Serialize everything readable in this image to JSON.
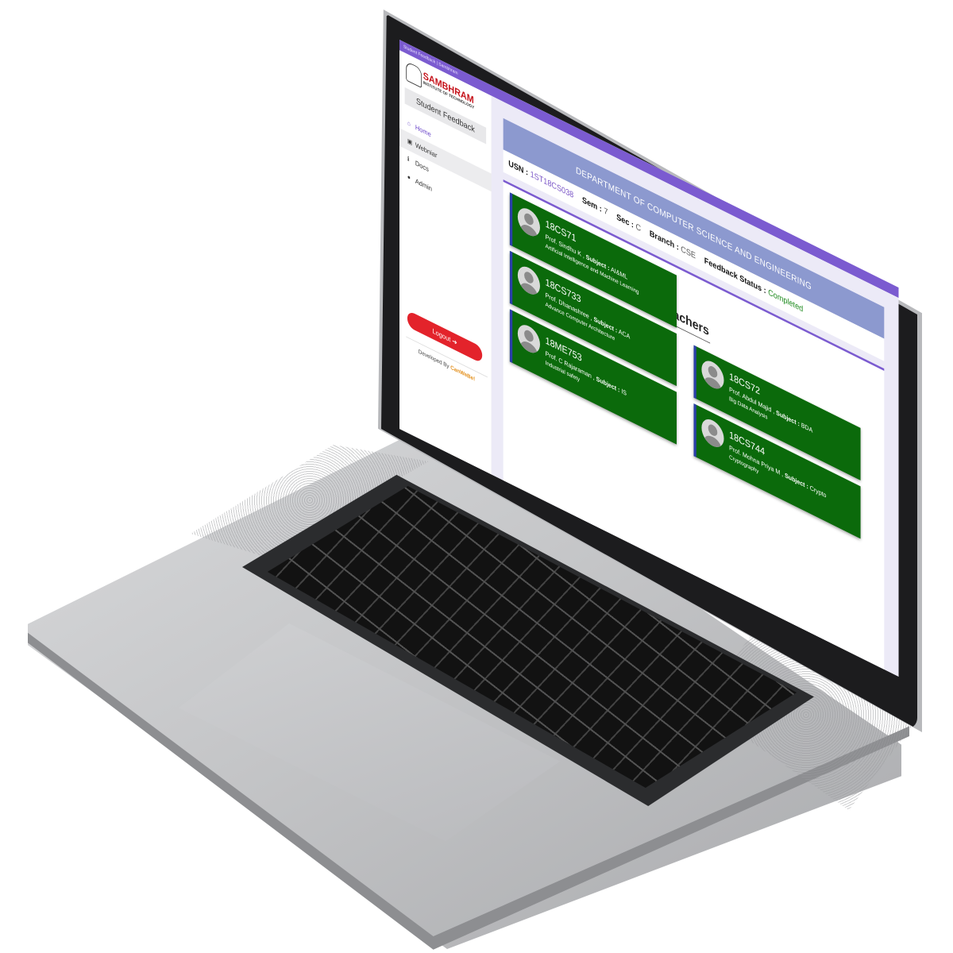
{
  "window": {
    "title": "Student Feedback | Sambhram"
  },
  "brand": {
    "name": "SAMBHRAM",
    "subtitle": "INSTITUTE OF TECHNOLOGY"
  },
  "sidebar": {
    "title": "Student Feedback",
    "items": [
      {
        "label": "Home",
        "icon": "home-icon"
      },
      {
        "label": "Webniar",
        "icon": "monitor-icon"
      },
      {
        "label": "Docs",
        "icon": "info-icon"
      },
      {
        "label": "Admin",
        "icon": "user-icon"
      }
    ],
    "logout_label": "Logout",
    "developed_by_prefix": "Developed By",
    "developed_by_name": "CanWeBe!"
  },
  "header": {
    "department": "DEPARTMENT OF COMPUTER SCIENCE AND ENGINEERING"
  },
  "student": {
    "usn_label": "USN :",
    "usn": "1ST18CS038",
    "sem_label": "Sem :",
    "sem": "7",
    "sec_label": "Sec :",
    "sec": "C",
    "branch_label": "Branch :",
    "branch": "CSE",
    "status_label": "Feedback Status :",
    "status": "Completed"
  },
  "teachers": {
    "title": "Teachers",
    "subject_label": "Subject :",
    "cards": [
      {
        "code": "18CS71",
        "prof": "Prof. Sindhu K ,",
        "subject": "AI&ML",
        "subject_name": "Artificial Intelligence and Machine Learning"
      },
      {
        "code": "18CS733",
        "prof": "Prof. Dhanashree ,",
        "subject": "ACA",
        "subject_name": "Advance Computer Architecture"
      },
      {
        "code": "18ME753",
        "prof": "Prof. C Rajaraman ,",
        "subject": "IS",
        "subject_name": "Industrial safety"
      },
      {
        "code": "18CS72",
        "prof": "Prof. Abdul Majid ,",
        "subject": "BDA",
        "subject_name": "Big Data Analysis"
      },
      {
        "code": "18CS744",
        "prof": "Prof. Mohna Priya M ,",
        "subject": "Crypto",
        "subject_name": "Cryptography"
      }
    ]
  },
  "colors": {
    "accent": "#7b5bd0",
    "card": "#0b6a0b",
    "logout": "#e3232b",
    "status": "#1f8b1f"
  }
}
